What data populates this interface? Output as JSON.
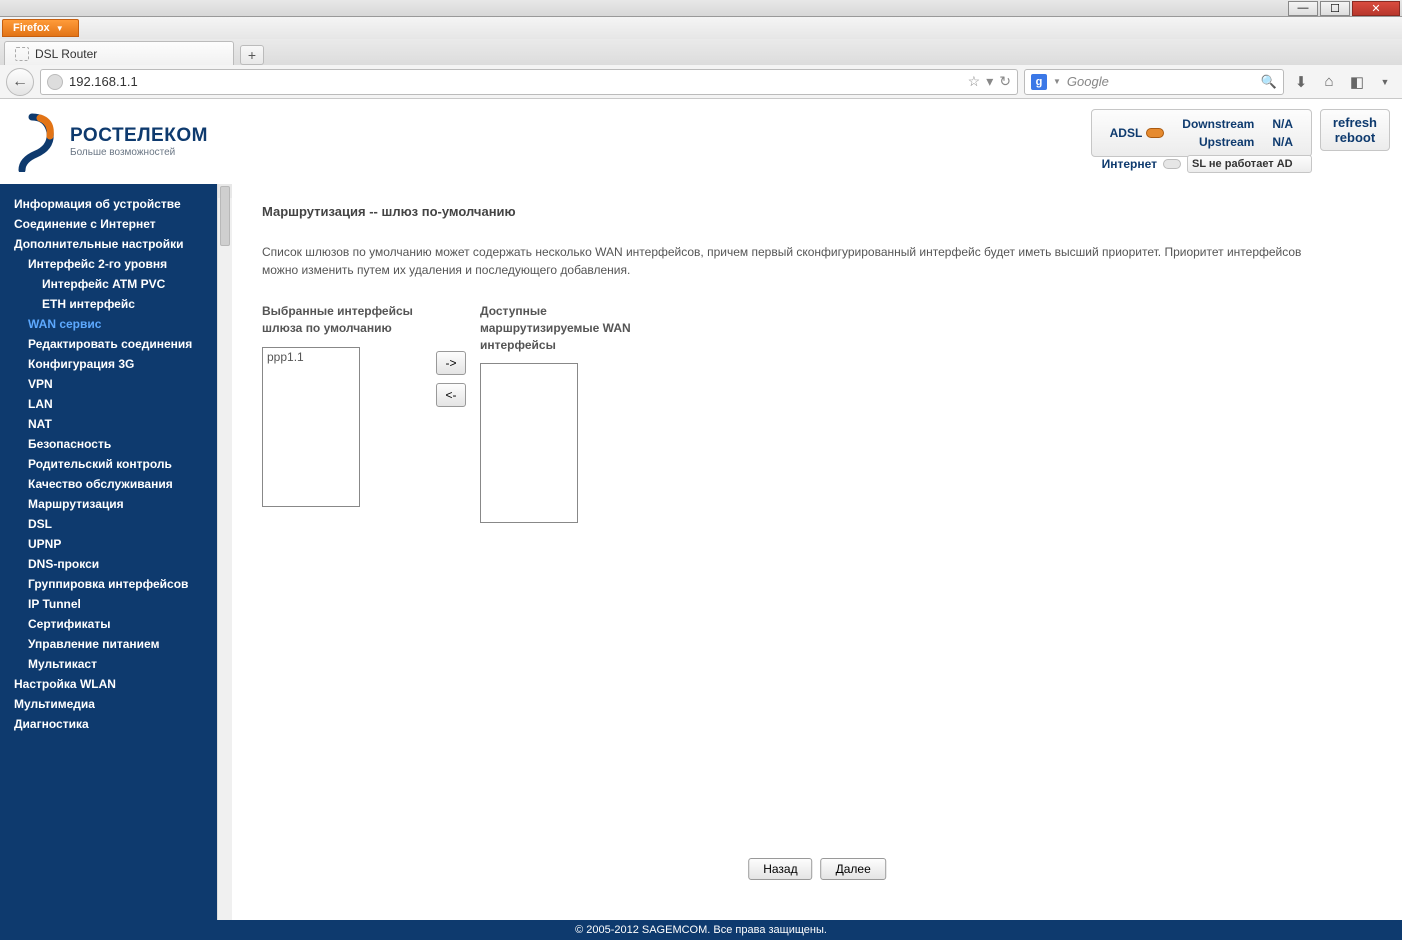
{
  "window": {
    "browser_label": "Firefox",
    "tab_title": "DSL Router",
    "url": "192.168.1.1",
    "search_placeholder": "Google"
  },
  "header": {
    "brand": "РОСТЕЛЕКОМ",
    "tagline": "Больше возможностей",
    "adsl_label": "ADSL",
    "downstream_label": "Downstream",
    "downstream_value": "N/A",
    "upstream_label": "Upstream",
    "upstream_value": "N/A",
    "internet_label": "Интернет",
    "internet_status": "SL не работает AD",
    "refresh": "refresh",
    "reboot": "reboot"
  },
  "sidebar": {
    "items": [
      {
        "label": "Информация об устройстве",
        "level": 0
      },
      {
        "label": "Соединение с Интернет",
        "level": 0
      },
      {
        "label": "Дополнительные настройки",
        "level": 0
      },
      {
        "label": "Интерфейс 2-го уровня",
        "level": 1
      },
      {
        "label": "Интерфейс ATM PVC",
        "level": 2
      },
      {
        "label": "ETH интерфейс",
        "level": 2
      },
      {
        "label": "WAN сервис",
        "level": 1,
        "active": true
      },
      {
        "label": "Редактировать соединения",
        "level": 1
      },
      {
        "label": "Конфигурация 3G",
        "level": 1
      },
      {
        "label": "VPN",
        "level": 1
      },
      {
        "label": "LAN",
        "level": 1
      },
      {
        "label": "NAT",
        "level": 1
      },
      {
        "label": "Безопасность",
        "level": 1
      },
      {
        "label": "Родительский контроль",
        "level": 1
      },
      {
        "label": "Качество обслуживания",
        "level": 1
      },
      {
        "label": "Маршрутизация",
        "level": 1
      },
      {
        "label": "DSL",
        "level": 1
      },
      {
        "label": "UPNP",
        "level": 1
      },
      {
        "label": "DNS-прокси",
        "level": 1
      },
      {
        "label": "Группировка интерфейсов",
        "level": 1
      },
      {
        "label": "IP Tunnel",
        "level": 1
      },
      {
        "label": "Сертификаты",
        "level": 1
      },
      {
        "label": "Управление питанием",
        "level": 1
      },
      {
        "label": "Мультикаст",
        "level": 1
      },
      {
        "label": "Настройка WLAN",
        "level": 0
      },
      {
        "label": "Мультимедиа",
        "level": 0
      },
      {
        "label": "Диагностика",
        "level": 0
      }
    ]
  },
  "content": {
    "title": "Маршрутизация -- шлюз по-умолчанию",
    "description": "Список шлюзов по умолчанию может содержать несколько WAN интерфейсов, причем первый сконфигурированный интерфейс будет иметь высший приоритет. Приоритет интерфейсов можно изменить путем их удаления и последующего добавления.",
    "selected_header": "Выбранные интерфейсы шлюза по умолчанию",
    "available_header": "Доступные маршрутизируемые WAN интерфейсы",
    "selected_items": [
      "ppp1.1"
    ],
    "available_items": [],
    "btn_right": "->",
    "btn_left": "<-",
    "btn_back": "Назад",
    "btn_next": "Далее"
  },
  "footer": "© 2005-2012 SAGEMCOM. Все права защищены."
}
